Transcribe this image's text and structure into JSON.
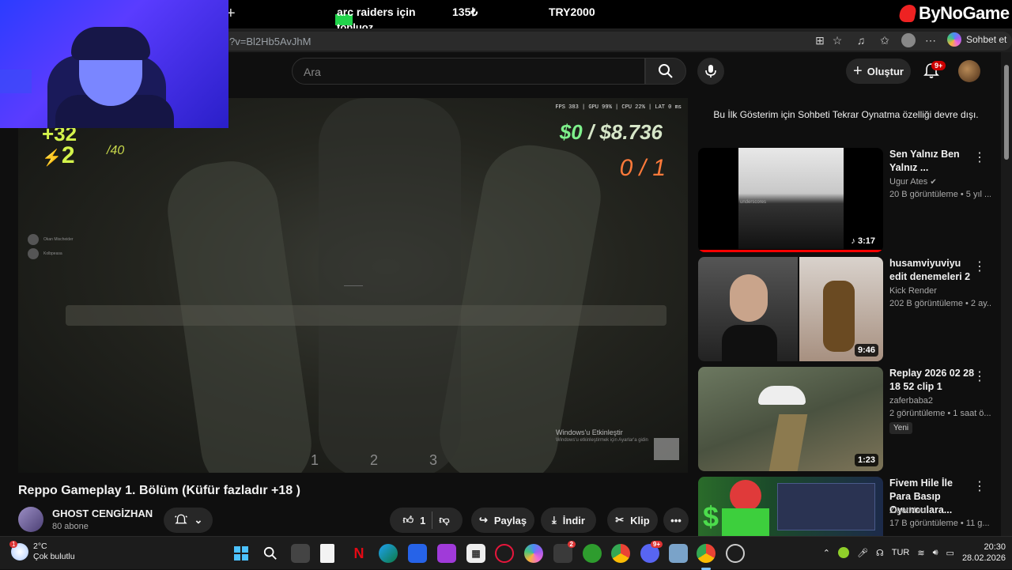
{
  "overlay": {
    "ticker_game": "arc raiders için",
    "ticker_price": "135₺",
    "ticker_currency_price": "TRY2000",
    "ticker_sub": "topluoz",
    "brand": "ByNoGame"
  },
  "browser": {
    "url": "?v=Bl2Hb5AvJhM",
    "copilot_label": "Sohbet et"
  },
  "youtube": {
    "search_placeholder": "Ara",
    "create_label": "Oluştur",
    "notif_badge": "9+"
  },
  "video": {
    "hud_health": "+32",
    "hud_armor": "2",
    "hud_armor_max": "/40",
    "hud_stats": "FPS 383 | GPU 99% | CPU 22% | LAT 0 ms",
    "hud_money_left": "$0",
    "hud_money_sep": "/",
    "hud_money_right": "$8.736",
    "hud_score": "0 / 1",
    "feed": [
      "Okan Mischeider",
      "Kolbpeasa"
    ],
    "slots": "1 2 3",
    "activate_title": "Windows'u Etkinleştir",
    "activate_sub": "Windows'u etkinleştirmek için Ayarlar'a gidin",
    "title": "Reppo Gameplay 1. Bölüm (Küfür fazladır +18 )",
    "channel": "GHOST CENGİZHAN",
    "subs": "80 abone",
    "likes": "1",
    "share": "Paylaş",
    "download": "İndir",
    "clip": "Klip"
  },
  "sidebar": {
    "chat_replay_notice": "Bu İlk Gösterim için Sohbeti Tekrar Oynatma özelliği devre dışı.",
    "recommendations": [
      {
        "title": "Sen Yalnız Ben Yalnız ...",
        "channel": "Ugur Ates",
        "meta": "20 B görüntüleme • 5 yıl ...",
        "duration": "3:17",
        "thumb_text": "underscores"
      },
      {
        "title": "husamviyuviyu edit denemeleri 2",
        "channel": "Kick Render",
        "meta": "202 B görüntüleme • 2 ay...",
        "duration": "9:46"
      },
      {
        "title": "Replay 2026 02 28 18 52 clip 1",
        "channel": "zaferbaba2",
        "meta": "2 görüntüleme • 1 saat ö...",
        "duration": "1:23",
        "badge": "Yeni"
      },
      {
        "title": "Fivem Hile İle Para Basıp Oyunculara...",
        "channel": "ZigotMen",
        "meta": "17 B görüntüleme • 11 g..."
      }
    ]
  },
  "taskbar": {
    "weather_temp": "2°C",
    "weather_desc": "Çok bulutlu",
    "weather_badge": "1",
    "xbox_badge": "2",
    "discord_badge": "9+",
    "lang": "TUR",
    "time": "20:30",
    "date": "28.02.2026"
  }
}
